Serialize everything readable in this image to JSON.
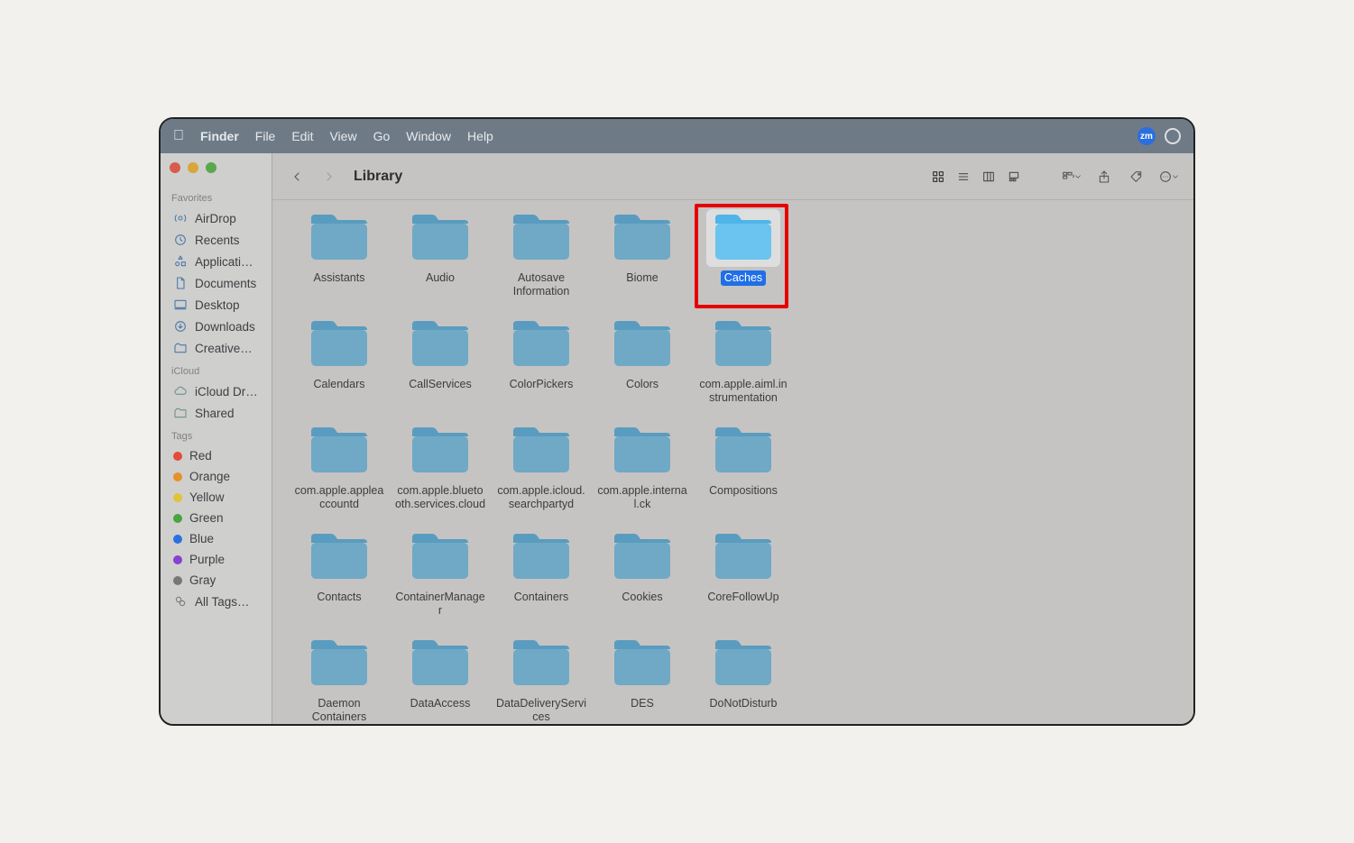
{
  "menubar": {
    "app": "Finder",
    "items": [
      "File",
      "Edit",
      "View",
      "Go",
      "Window",
      "Help"
    ],
    "right_badge": "zm"
  },
  "sidebar": {
    "sections": [
      {
        "title": "Favorites",
        "items": [
          {
            "icon": "airdrop",
            "label": "AirDrop"
          },
          {
            "icon": "recents",
            "label": "Recents"
          },
          {
            "icon": "apps",
            "label": "Applicati…"
          },
          {
            "icon": "doc",
            "label": "Documents"
          },
          {
            "icon": "desktop",
            "label": "Desktop"
          },
          {
            "icon": "downloads",
            "label": "Downloads"
          },
          {
            "icon": "creative",
            "label": "Creative…"
          }
        ]
      },
      {
        "title": "iCloud",
        "items": [
          {
            "icon": "cloud",
            "label": "iCloud Dri…"
          },
          {
            "icon": "shared",
            "label": "Shared"
          }
        ]
      },
      {
        "title": "Tags",
        "items": [
          {
            "color": "#e24b3b",
            "label": "Red"
          },
          {
            "color": "#e69127",
            "label": "Orange"
          },
          {
            "color": "#e0c23b",
            "label": "Yellow"
          },
          {
            "color": "#4aa340",
            "label": "Green"
          },
          {
            "color": "#2e6fe0",
            "label": "Blue"
          },
          {
            "color": "#8743ce",
            "label": "Purple"
          },
          {
            "color": "#777",
            "label": "Gray"
          },
          {
            "icon": "alltags",
            "label": "All Tags…"
          }
        ]
      }
    ]
  },
  "toolbar": {
    "title": "Library"
  },
  "folders": [
    {
      "label": "Assistants"
    },
    {
      "label": "Audio"
    },
    {
      "label": "Autosave Information"
    },
    {
      "label": "Biome"
    },
    {
      "label": "Caches",
      "selected": true,
      "highlighted": true
    },
    {
      "label": "Calendars"
    },
    {
      "label": "CallServices"
    },
    {
      "label": "ColorPickers"
    },
    {
      "label": "Colors"
    },
    {
      "label": "com.apple.aiml.instrumentation"
    },
    {
      "label": "com.apple.appleaccountd"
    },
    {
      "label": "com.apple.bluetooth.services.cloud"
    },
    {
      "label": "com.apple.icloud.searchpartyd"
    },
    {
      "label": "com.apple.internal.ck"
    },
    {
      "label": "Compositions"
    },
    {
      "label": "Contacts"
    },
    {
      "label": "ContainerManager"
    },
    {
      "label": "Containers"
    },
    {
      "label": "Cookies"
    },
    {
      "label": "CoreFollowUp"
    },
    {
      "label": "Daemon Containers"
    },
    {
      "label": "DataAccess"
    },
    {
      "label": "DataDeliveryServices"
    },
    {
      "label": "DES"
    },
    {
      "label": "DoNotDisturb"
    }
  ],
  "colors": {
    "folder_top": "#5a9cbf",
    "folder_body": "#6fa9c6",
    "folder_selected_top": "#4fb5e8",
    "folder_selected_body": "#6ac4ef"
  }
}
